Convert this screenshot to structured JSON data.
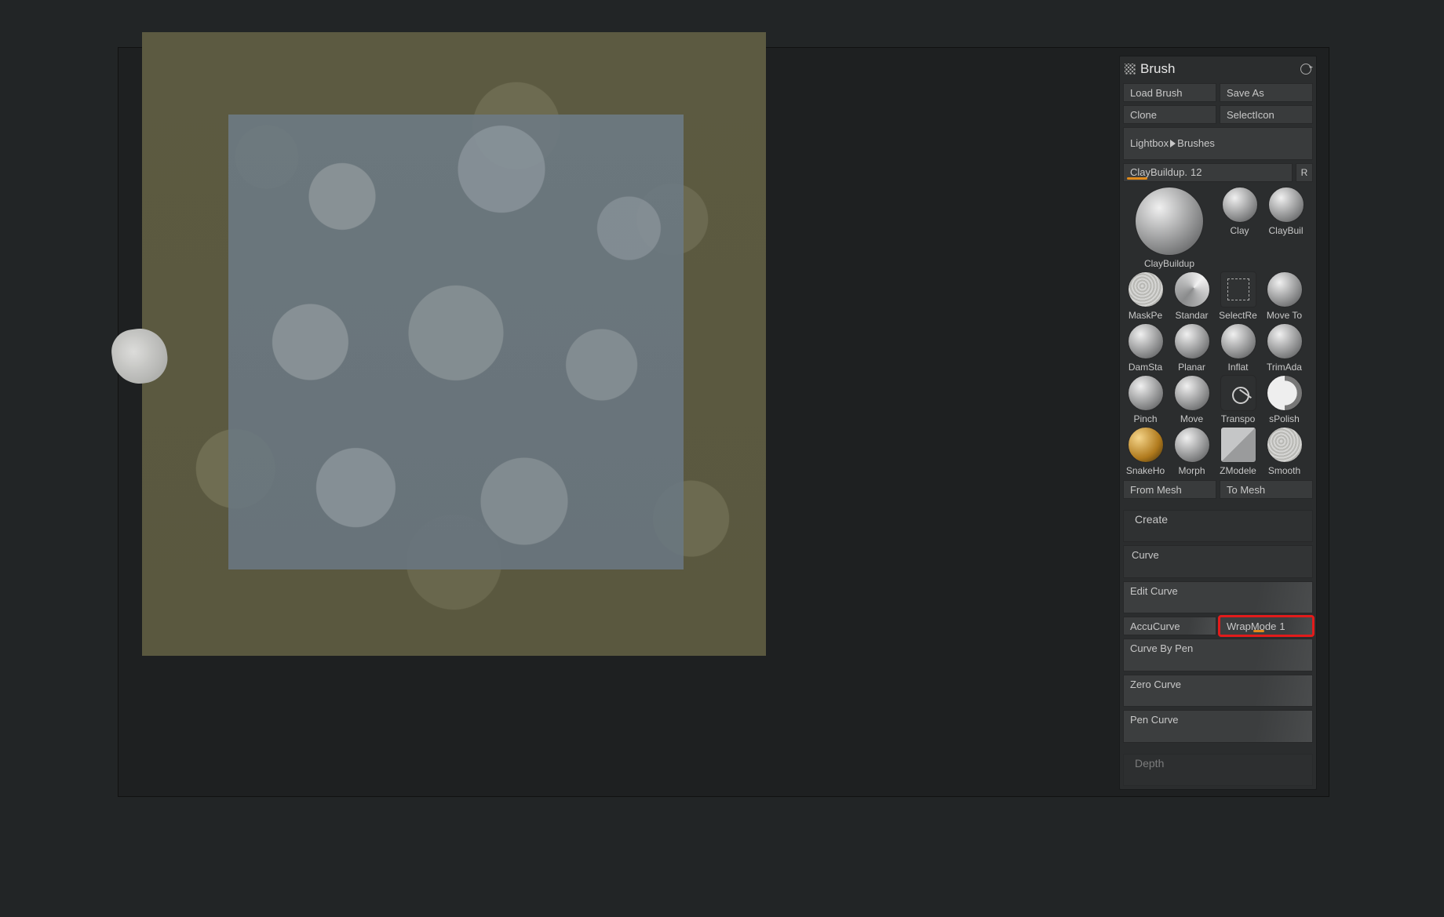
{
  "panel": {
    "title": "Brush",
    "buttons": {
      "load": "Load Brush",
      "save": "Save As",
      "clone": "Clone",
      "selectIcon": "SelectIcon",
      "lightbox_prefix": "Lightbox",
      "lightbox_suffix": "Brushes",
      "fromMesh": "From Mesh",
      "toMesh": "To Mesh",
      "r": "R"
    },
    "mainSlider": {
      "label": "ClayBuildup.",
      "value": "12",
      "barWidthPx": 26
    }
  },
  "brushes": [
    {
      "label": "ClayBuildup",
      "big": true,
      "style": ""
    },
    {
      "label": "Clay",
      "style": ""
    },
    {
      "label": "ClayBuil",
      "style": ""
    },
    {
      "label": "MaskPe",
      "style": "noise"
    },
    {
      "label": "Standar",
      "style": "swirl"
    },
    {
      "label": "SelectRe",
      "style": "square"
    },
    {
      "label": "Move To",
      "style": ""
    },
    {
      "label": "DamSta",
      "style": ""
    },
    {
      "label": "Planar",
      "style": ""
    },
    {
      "label": "Inflat",
      "style": ""
    },
    {
      "label": "TrimAda",
      "style": ""
    },
    {
      "label": "Pinch",
      "style": ""
    },
    {
      "label": "Move",
      "style": ""
    },
    {
      "label": "Transpo",
      "style": "gizmo"
    },
    {
      "label": "sPolish",
      "style": "half"
    },
    {
      "label": "SnakeHo",
      "style": "hook"
    },
    {
      "label": "Morph",
      "style": ""
    },
    {
      "label": "ZModele",
      "style": "cube"
    },
    {
      "label": "Smooth",
      "style": "noise"
    }
  ],
  "sections": {
    "create": "Create",
    "curve": "Curve",
    "depth": "Depth",
    "curveItems": {
      "edit": "Edit Curve",
      "accu": "AccuCurve",
      "wrapLabel": "WrapMode",
      "wrapValue": "1",
      "byPen": "Curve By Pen",
      "zero": "Zero Curve",
      "pen": "Pen Curve"
    }
  }
}
